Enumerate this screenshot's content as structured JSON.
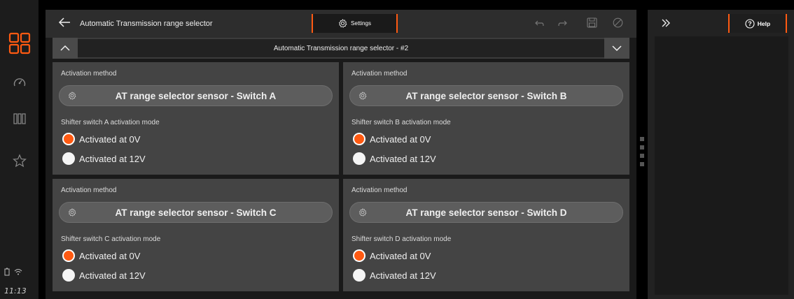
{
  "header": {
    "back_icon": "arrow-left-icon",
    "title": "Automatic Transmission range selector",
    "settings_label": "Settings"
  },
  "toolbar": {
    "undo_icon": "undo-icon",
    "redo_icon": "redo-icon",
    "save_icon": "save-icon",
    "cancel_icon": "cancel-icon"
  },
  "selector": {
    "label": "Automatic Transmission range selector - #2"
  },
  "right_panel": {
    "expand_icon": "double-chevron-right-icon",
    "help_label": "Help"
  },
  "status": {
    "time": "11:13"
  },
  "cards": [
    {
      "activation_label": "Activation method",
      "sensor_label": "AT range selector sensor - Switch A",
      "mode_label": "Shifter switch A activation mode",
      "options": [
        {
          "label": "Activated at 0V",
          "selected": true
        },
        {
          "label": "Activated at 12V",
          "selected": false
        }
      ]
    },
    {
      "activation_label": "Activation method",
      "sensor_label": "AT range selector sensor - Switch B",
      "mode_label": "Shifter switch B activation mode",
      "options": [
        {
          "label": "Activated at 0V",
          "selected": true
        },
        {
          "label": "Activated at 12V",
          "selected": false
        }
      ]
    },
    {
      "activation_label": "Activation method",
      "sensor_label": "AT range selector sensor - Switch C",
      "mode_label": "Shifter switch C activation mode",
      "options": [
        {
          "label": "Activated at 0V",
          "selected": true
        },
        {
          "label": "Activated at 12V",
          "selected": false
        }
      ]
    },
    {
      "activation_label": "Activation method",
      "sensor_label": "AT range selector sensor - Switch D",
      "mode_label": "Shifter switch D activation mode",
      "options": [
        {
          "label": "Activated at 0V",
          "selected": true
        },
        {
          "label": "Activated at 12V",
          "selected": false
        }
      ]
    }
  ],
  "colors": {
    "accent": "#ff5a12",
    "panel": "#444444",
    "background": "#1a1a1a"
  }
}
